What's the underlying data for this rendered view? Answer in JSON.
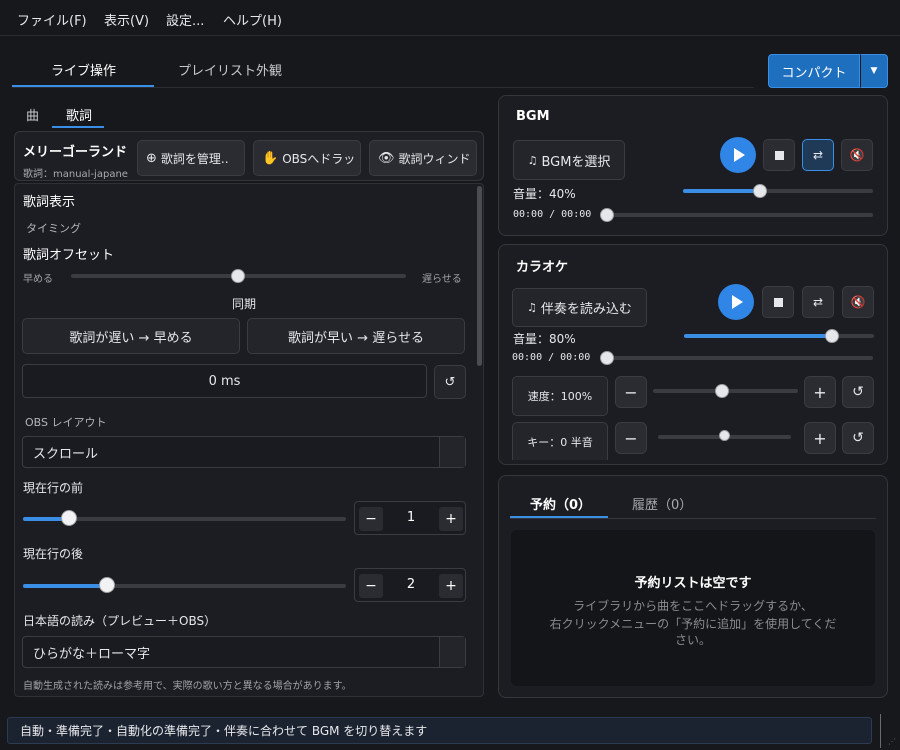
{
  "menubar": {
    "items": [
      "ファイル(F)",
      "表示(V)",
      "設定...",
      "ヘルプ(H)"
    ]
  },
  "top_tabs": {
    "items": [
      "ライブ操作",
      "プレイリスト外観"
    ],
    "active": "ライブ操作"
  },
  "compact_button": {
    "label": "コンパクト"
  },
  "sub_tabs": {
    "items": [
      "曲",
      "歌詞"
    ],
    "active": "歌詞"
  },
  "song": {
    "title": "メリーゴーランド",
    "subtitle": "歌詞：manual-japane",
    "buttons": {
      "manage": "歌詞を管理..",
      "obs_drag": "OBSへドラッ",
      "window": "歌詞ウィンド"
    }
  },
  "lyrics_panel": {
    "section_title": "歌詞表示",
    "timing_label": "タイミング",
    "offset_label": "歌詞オフセット",
    "offset_left": "早める",
    "offset_right": "遅らせる",
    "offset_position": 0.5,
    "sync_label": "同期",
    "sync_earlier": "歌詞が遅い → 早める",
    "sync_later": "歌詞が早い → 遅らせる",
    "offset_value": "0 ms",
    "obs_layout_label": "OBS レイアウト",
    "obs_layout_value": "スクロール",
    "before_label": "現在行の前",
    "before_value": "1",
    "after_label": "現在行の後",
    "after_value": "2",
    "reading_label": "日本語の読み（プレビュー＋OBS）",
    "reading_value": "ひらがな＋ローマ字",
    "note": "自動生成された読みは参考用で、実際の歌い方と異なる場合があります。"
  },
  "bgm": {
    "title": "BGM",
    "select_label": "BGMを選択",
    "volume_label": "音量：40%",
    "volume": 0.4,
    "time": "00:00 / 00:00",
    "progress": 0,
    "loop_active": true
  },
  "karaoke": {
    "title": "カラオケ",
    "load_label": "伴奏を読み込む",
    "volume_label": "音量：80%",
    "volume": 0.8,
    "time": "00:00 / 00:00",
    "progress": 0,
    "speed_label": "速度：100%",
    "speed_position": 0.5,
    "key_label": "キー：0 半音",
    "key_position": 0.5
  },
  "queue": {
    "tabs": [
      "予約（0）",
      "履歴（0）"
    ],
    "active": "予約（0）",
    "empty_title": "予約リストは空です",
    "empty_line1": "ライブラリから曲をここへドラッグするか、",
    "empty_line2": "右クリックメニューの「予約に追加」を使用してくだ",
    "empty_line3": "さい。"
  },
  "status": {
    "text": "自動・準備完了・自動化の準備完了・伴奏に合わせて BGM を切り替えます"
  },
  "colors": {
    "accent": "#3a8ee6",
    "background": "#17181c",
    "panel": "#1c1d22"
  }
}
